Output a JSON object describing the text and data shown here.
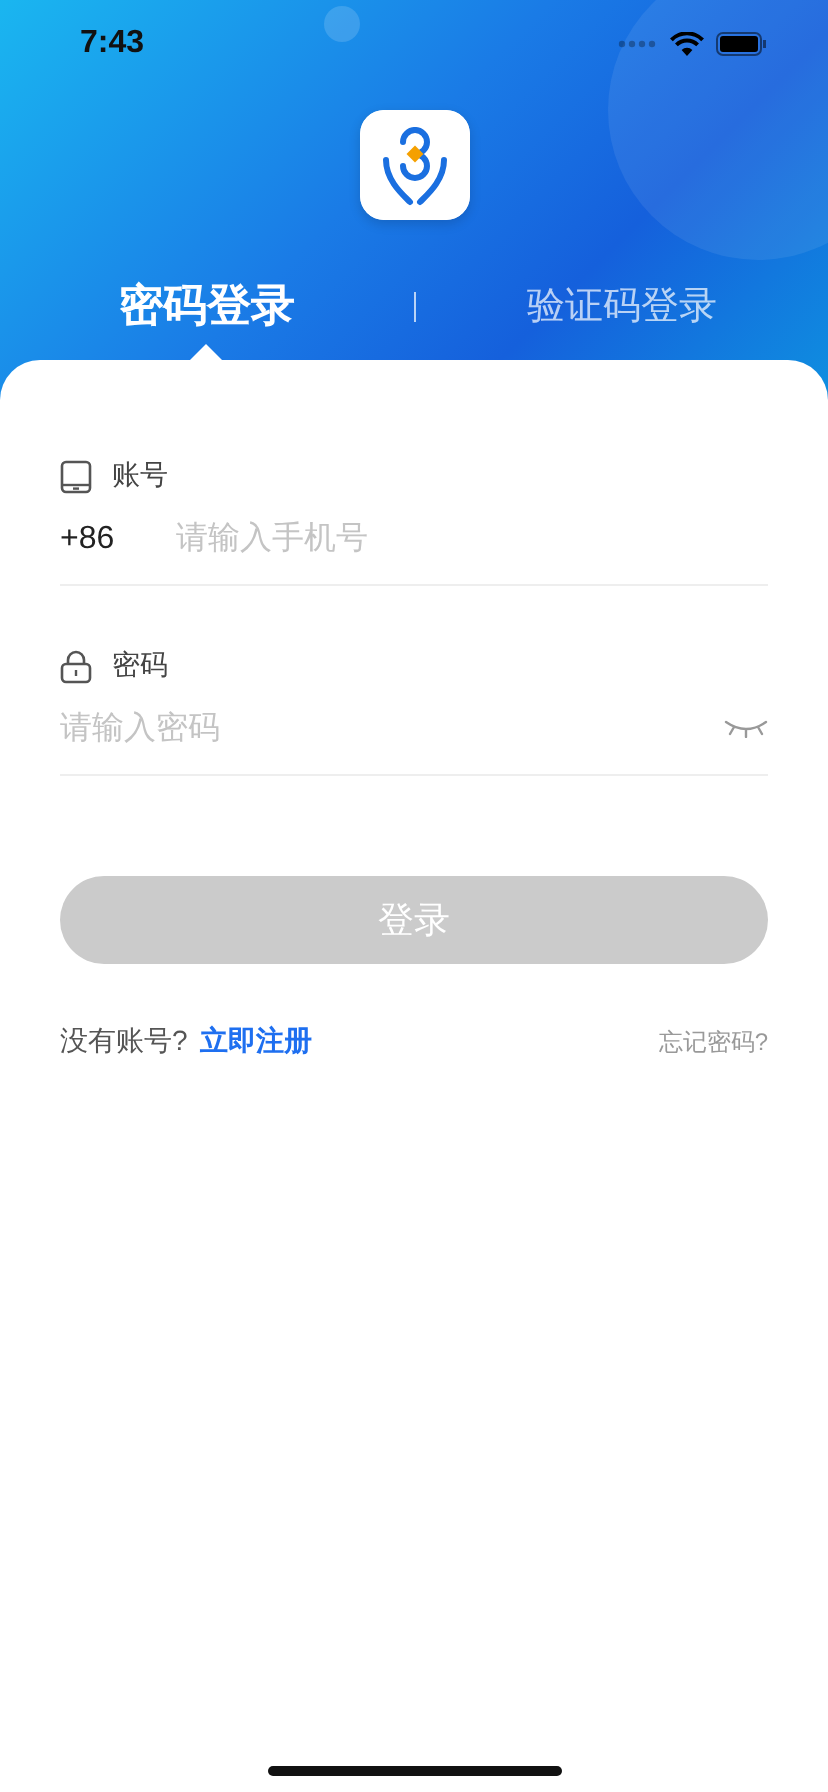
{
  "status_bar": {
    "time": "7:43"
  },
  "tabs": [
    {
      "label": "密码登录",
      "selected": true
    },
    {
      "label": "验证码登录",
      "selected": false
    }
  ],
  "account": {
    "label": "账号",
    "prefix": "+86",
    "placeholder": "请输入手机号"
  },
  "password": {
    "label": "密码",
    "placeholder": "请输入密码",
    "visible": false
  },
  "login_button": {
    "label": "登录",
    "disabled": true
  },
  "footer": {
    "prompt": "没有账号?",
    "register_link": "立即注册",
    "forgot_link": "忘记密码?"
  }
}
